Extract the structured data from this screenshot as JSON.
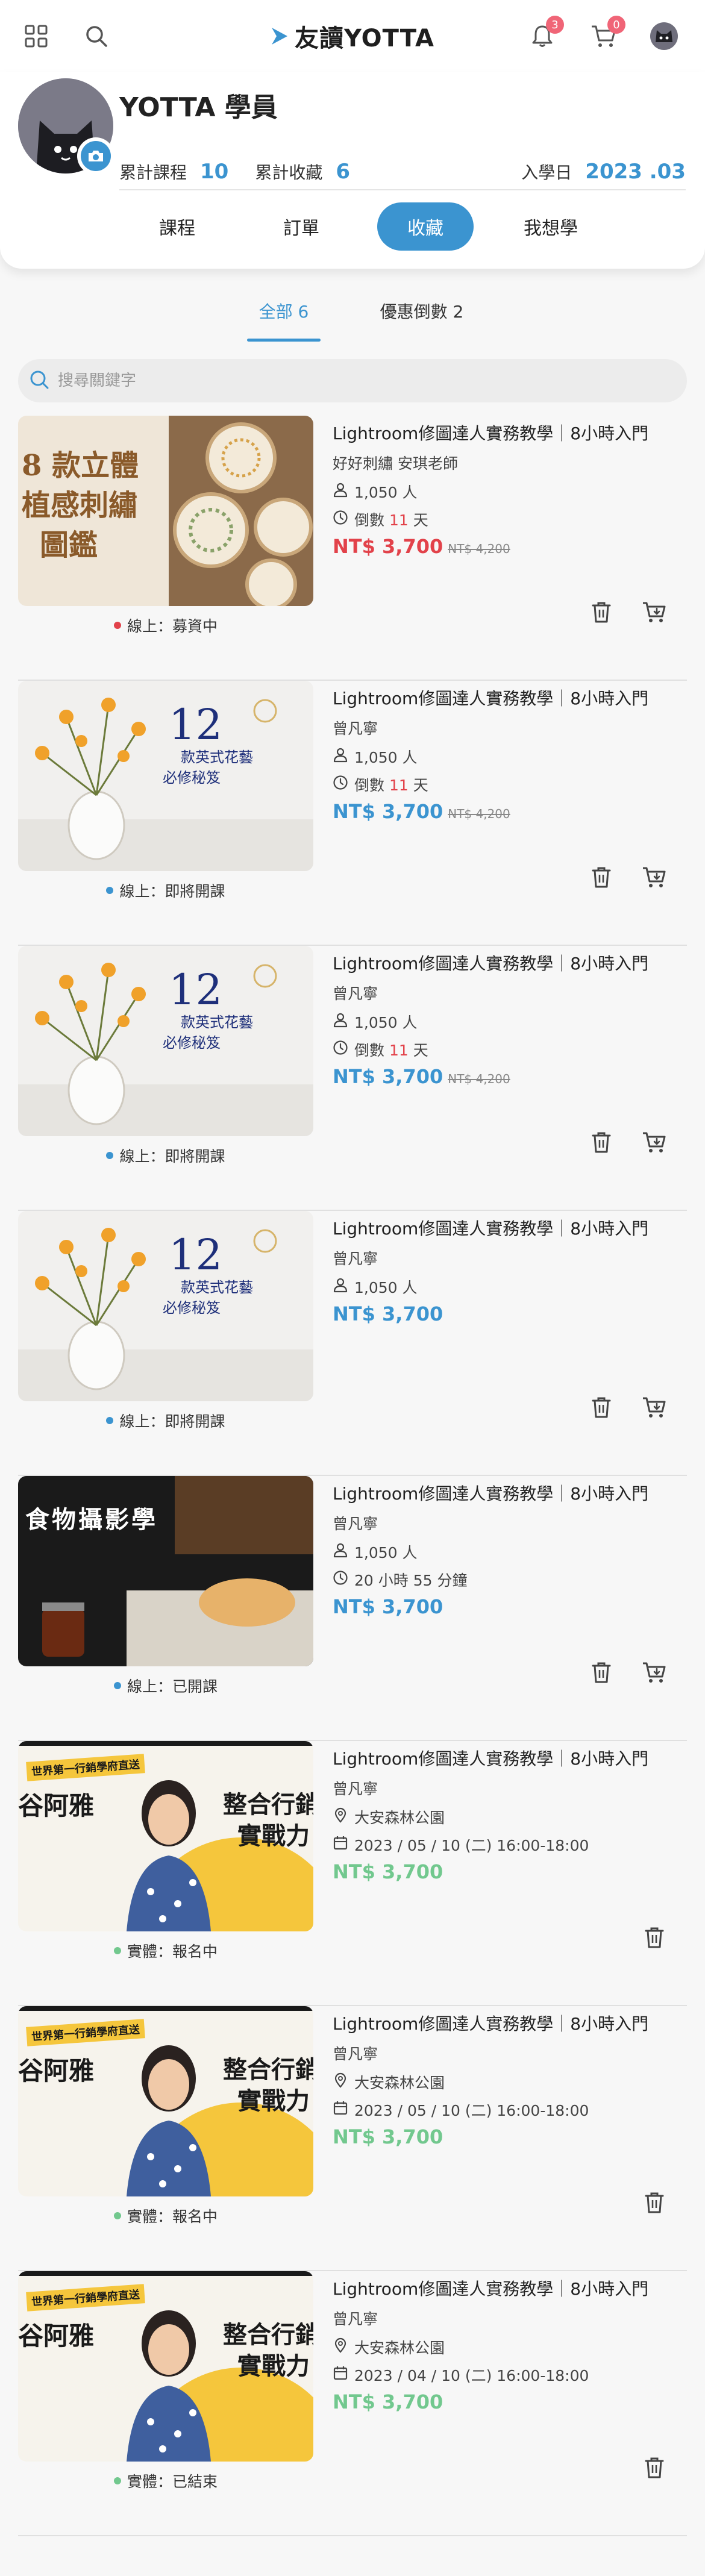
{
  "brand": {
    "name": "友讀YOTTA",
    "accent": "#3b94d0"
  },
  "header": {
    "notification_count": "3",
    "cart_count": "0"
  },
  "profile": {
    "name": "YOTTA 學員",
    "courses_label": "累計課程",
    "courses_value": "10",
    "collected_label": "累計收藏",
    "collected_value": "6",
    "join_label": "入學日",
    "join_value": "2023 .03"
  },
  "tabs": [
    {
      "label": "課程"
    },
    {
      "label": "訂單"
    },
    {
      "label": "收藏",
      "active": true
    },
    {
      "label": "我想學"
    }
  ],
  "subtabs": [
    {
      "label": "全部 6",
      "active": true
    },
    {
      "label": "優惠倒數 2"
    }
  ],
  "search": {
    "placeholder": "搜尋關鍵字"
  },
  "colors": {
    "price_online": "#3b94d0",
    "price_offline": "#72c88e",
    "price_sale": "#e2424a",
    "dot_red": "#e2424a",
    "dot_blue": "#3b94d0",
    "dot_green": "#72c88e"
  },
  "courses": [
    {
      "title": "Lightroom修圖達人實務教學｜8小時入門",
      "teacher": "好好刺繡 安琪老師",
      "students": "1,050 人",
      "countdown_prefix": "倒數 ",
      "countdown_value": "11",
      "countdown_suffix": " 天",
      "price": "NT$ 3,700",
      "old_price": "NT$ 4,200",
      "status": "線上：募資中",
      "thumb_lines": [
        "8 款立體",
        "植感刺繡",
        "圖鑑"
      ]
    },
    {
      "title": "Lightroom修圖達人實務教學｜8小時入門",
      "teacher": "曾凡寧",
      "students": "1,050 人",
      "countdown_prefix": "倒數 ",
      "countdown_value": "11",
      "countdown_suffix": " 天",
      "price": "NT$ 3,700",
      "old_price": "NT$ 4,200",
      "status": "線上：即將開課",
      "thumb_lines": [
        "12",
        "款英式花藝",
        "必修秘笈"
      ]
    },
    {
      "title": "Lightroom修圖達人實務教學｜8小時入門",
      "teacher": "曾凡寧",
      "students": "1,050 人",
      "countdown_prefix": "倒數 ",
      "countdown_value": "11",
      "countdown_suffix": " 天",
      "price": "NT$ 3,700",
      "old_price": "NT$ 4,200",
      "status": "線上：即將開課",
      "thumb_lines": [
        "12",
        "款英式花藝",
        "必修秘笈"
      ]
    },
    {
      "title": "Lightroom修圖達人實務教學｜8小時入門",
      "teacher": "曾凡寧",
      "students": "1,050 人",
      "price": "NT$ 3,700",
      "status": "線上：即將開課",
      "thumb_lines": [
        "12",
        "款英式花藝",
        "必修秘笈"
      ]
    },
    {
      "title": "Lightroom修圖達人實務教學｜8小時入門",
      "teacher": "曾凡寧",
      "students": "1,050 人",
      "duration": "20 小時 55 分鐘",
      "price": "NT$ 3,700",
      "status": "線上：已開課",
      "thumb_lines": [
        "食物攝影學"
      ]
    },
    {
      "title": "Lightroom修圖達人實務教學｜8小時入門",
      "teacher": "曾凡寧",
      "location": "大安森林公園",
      "datetime": "2023 / 05 / 10 (二) 16:00-18:00",
      "price": "NT$ 3,700",
      "status": "實體：報名中",
      "thumb_lines": [
        "世界第一行銷學府直送",
        "谷阿雅",
        "整合行銷",
        "實戰力"
      ]
    },
    {
      "title": "Lightroom修圖達人實務教學｜8小時入門",
      "teacher": "曾凡寧",
      "location": "大安森林公園",
      "datetime": "2023 / 05 / 10 (二) 16:00-18:00",
      "price": "NT$ 3,700",
      "status": "實體：報名中",
      "thumb_lines": [
        "世界第一行銷學府直送",
        "谷阿雅",
        "整合行銷",
        "實戰力"
      ]
    },
    {
      "title": "Lightroom修圖達人實務教學｜8小時入門",
      "teacher": "曾凡寧",
      "location": "大安森林公園",
      "datetime": "2023 / 04 / 10 (二) 16:00-18:00",
      "price": "NT$ 3,700",
      "status": "實體：已結束",
      "thumb_lines": [
        "世界第一行銷學府直送",
        "谷阿雅",
        "整合行銷",
        "實戰力"
      ]
    }
  ]
}
